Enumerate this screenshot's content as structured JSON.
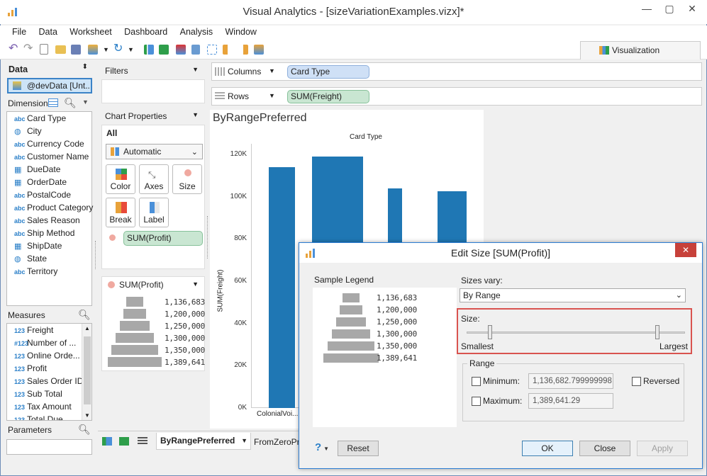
{
  "window": {
    "title": "Visual Analytics - [sizeVariationExamples.vizx]*"
  },
  "menu": [
    "File",
    "Data",
    "Worksheet",
    "Dashboard",
    "Analysis",
    "Window"
  ],
  "visualization_tab": "Visualization",
  "data_panel": {
    "title": "Data",
    "datasource": "@devData [Unt...",
    "dimensions_label": "Dimensions",
    "dimensions": [
      {
        "type": "abc",
        "label": "Card Type"
      },
      {
        "type": "geo",
        "label": "City"
      },
      {
        "type": "abc",
        "label": "Currency Code"
      },
      {
        "type": "abc",
        "label": "Customer Name"
      },
      {
        "type": "date",
        "label": "DueDate"
      },
      {
        "type": "date",
        "label": "OrderDate"
      },
      {
        "type": "abc",
        "label": "PostalCode"
      },
      {
        "type": "abc",
        "label": "Product Category"
      },
      {
        "type": "abc",
        "label": "Sales Reason"
      },
      {
        "type": "abc",
        "label": "Ship Method"
      },
      {
        "type": "date",
        "label": "ShipDate"
      },
      {
        "type": "geo",
        "label": "State"
      },
      {
        "type": "abc",
        "label": "Territory"
      }
    ],
    "measures_label": "Measures",
    "measures": [
      {
        "type": "123",
        "label": "Freight"
      },
      {
        "type": "#123",
        "label": "Number of ..."
      },
      {
        "type": "123",
        "label": "Online Orde..."
      },
      {
        "type": "123",
        "label": "Profit"
      },
      {
        "type": "123",
        "label": "Sales Order ID"
      },
      {
        "type": "123",
        "label": "Sub Total"
      },
      {
        "type": "123",
        "label": "Tax Amount"
      },
      {
        "type": "123",
        "label": "Total Due"
      }
    ],
    "parameters_label": "Parameters"
  },
  "filters": {
    "title": "Filters"
  },
  "chart_properties": {
    "title": "Chart Properties",
    "scope": "All",
    "mark_type": "Automatic",
    "buttons": [
      "Color",
      "Axes",
      "Size",
      "Break",
      "Label"
    ],
    "size_pill": "SUM(Profit)"
  },
  "legend_panel": {
    "title": "SUM(Profit)",
    "values": [
      "1,136,683",
      "1,200,000",
      "1,250,000",
      "1,300,000",
      "1,350,000",
      "1,389,641"
    ]
  },
  "shelves": {
    "columns_label": "Columns",
    "columns_pill": "Card Type",
    "rows_label": "Rows",
    "rows_pill": "SUM(Freight)"
  },
  "sheet_tabs": [
    "ByRangePreferred",
    "FromZeroPre"
  ],
  "chart_data": {
    "type": "bar",
    "title": "ByRangePreferred",
    "xlabel": "Card Type",
    "ylabel": "SUM(Freight)",
    "ylim": [
      0,
      125000
    ],
    "yticks": [
      "0K",
      "20K",
      "40K",
      "60K",
      "80K",
      "100K",
      "120K"
    ],
    "categories": [
      "ColonialVoi...",
      "",
      "",
      ""
    ],
    "values": [
      114000,
      119000,
      104000,
      102500
    ],
    "color": "#1f77b4"
  },
  "dialog": {
    "title": "Edit Size [SUM(Profit)]",
    "sample_legend_label": "Sample Legend",
    "legend_values": [
      "1,136,683",
      "1,200,000",
      "1,250,000",
      "1,300,000",
      "1,350,000",
      "1,389,641"
    ],
    "sizes_vary_label": "Sizes vary:",
    "sizes_vary_value": "By Range",
    "size_label": "Size:",
    "smallest_label": "Smallest",
    "largest_label": "Largest",
    "range_label": "Range",
    "minimum_label": "Minimum:",
    "minimum_value": "1,136,682.799999998",
    "maximum_label": "Maximum:",
    "maximum_value": "1,389,641.29",
    "reversed_label": "Reversed",
    "reset": "Reset",
    "ok": "OK",
    "close": "Close",
    "apply": "Apply",
    "accent": "#d9534f"
  }
}
